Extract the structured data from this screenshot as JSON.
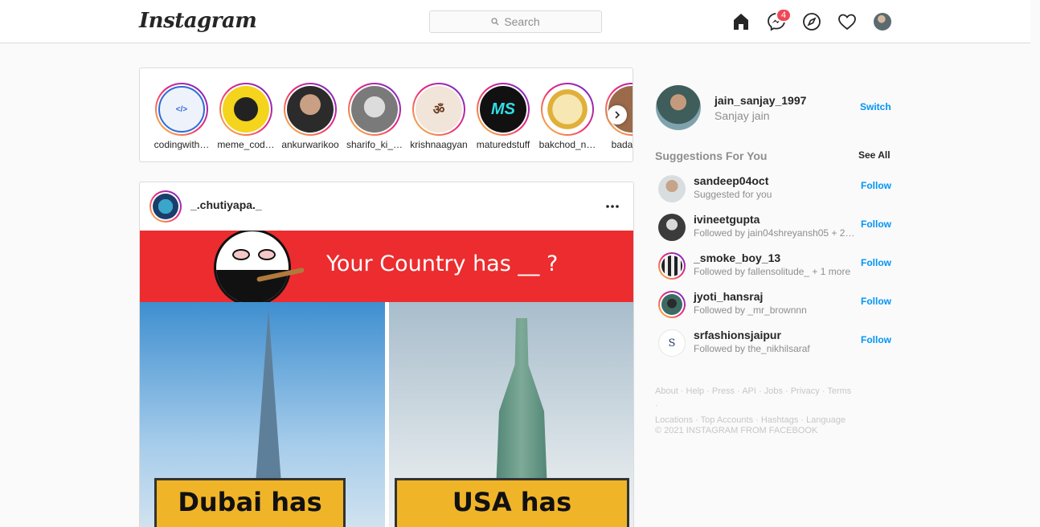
{
  "header": {
    "logo": "Instagram",
    "search_placeholder": "Search",
    "messenger_badge": "4"
  },
  "stories": [
    {
      "username": "codingwith…"
    },
    {
      "username": "meme_cod…"
    },
    {
      "username": "ankurwarikoo"
    },
    {
      "username": "sharifo_ki_…"
    },
    {
      "username": "krishnaagyan"
    },
    {
      "username": "maturedstuff"
    },
    {
      "username": "bakchod_n…"
    },
    {
      "username": "badass…"
    }
  ],
  "post": {
    "username": "_.chutiyapa._",
    "image_texts": {
      "question": "Your Country has __ ?",
      "left_sign": "Dubai has",
      "right_sign": "USA has"
    }
  },
  "profile": {
    "username": "jain_sanjay_1997",
    "full_name": "Sanjay jain",
    "switch_label": "Switch"
  },
  "suggestions": {
    "title": "Suggestions For You",
    "see_all": "See All",
    "follow_label": "Follow",
    "items": [
      {
        "username": "sandeep04oct",
        "subtitle": "Suggested for you"
      },
      {
        "username": "ivineetgupta",
        "subtitle": "Followed by jain04shreyansh05 + 2…"
      },
      {
        "username": "_smoke_boy_13",
        "subtitle": "Followed by fallensolitude_ + 1 more"
      },
      {
        "username": "jyoti_hansraj",
        "subtitle": "Followed by _mr_brownnn"
      },
      {
        "username": "srfashionsjaipur",
        "subtitle": "Followed by the_nikhilsaraf"
      }
    ]
  },
  "footer": {
    "links_line1": "About · Help · Press · API · Jobs · Privacy · Terms ·",
    "links_line2": "Locations · Top Accounts · Hashtags · Language",
    "copyright": "© 2021 INSTAGRAM FROM FACEBOOK"
  }
}
